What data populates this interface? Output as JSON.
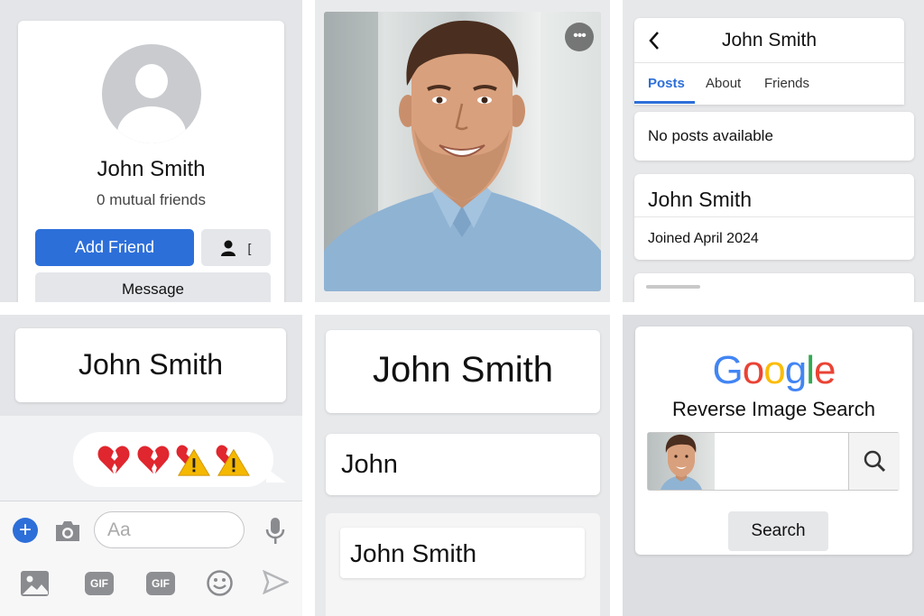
{
  "profile_card": {
    "name": "John Smith",
    "mutual": "0 mutual friends",
    "add_friend_label": "Add Friend",
    "icon_button_char": "[",
    "message_label": "Message"
  },
  "photo_panel": {
    "more_label": "•••"
  },
  "profile_page": {
    "title": "John Smith",
    "tabs": [
      {
        "label": "Posts",
        "active": true
      },
      {
        "label": "About",
        "active": false
      },
      {
        "label": "Friends",
        "active": false
      }
    ],
    "no_posts": "No posts available",
    "info_name": "John Smith",
    "joined": "Joined April 2024"
  },
  "messenger": {
    "contact_name": "John Smith",
    "message_emojis": [
      "broken-heart-icon",
      "broken-heart-icon",
      "broken-heart-warning-icon",
      "broken-heart-warning-icon"
    ],
    "input_placeholder": "Aa",
    "gif_label": "GIF"
  },
  "name_cards": {
    "card_1": "John Smith",
    "card_2": "John",
    "card_3": "John Smith"
  },
  "reverse_search": {
    "logo_letters": [
      {
        "ch": "G",
        "color": "#4285F4"
      },
      {
        "ch": "o",
        "color": "#EA4335"
      },
      {
        "ch": "o",
        "color": "#FBBC05"
      },
      {
        "ch": "g",
        "color": "#4285F4"
      },
      {
        "ch": "l",
        "color": "#34A853"
      },
      {
        "ch": "e",
        "color": "#EA4335"
      }
    ],
    "subtitle": "Reverse Image Search",
    "search_button": "Search"
  },
  "colors": {
    "accent": "#2d6fd9",
    "button_grey": "#e4e6ea"
  }
}
